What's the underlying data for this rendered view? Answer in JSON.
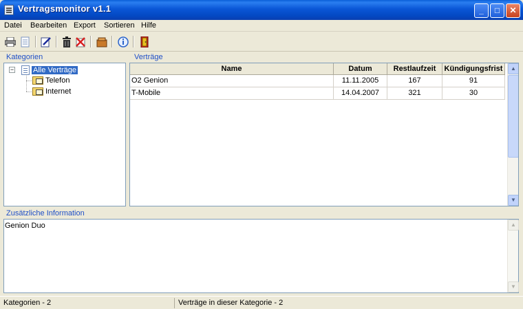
{
  "window": {
    "title": "Vertragsmonitor v1.1"
  },
  "menu": [
    "Datei",
    "Bearbeiten",
    "Export",
    "Sortieren",
    "Hilfe"
  ],
  "toolbar_icons": [
    "print-icon",
    "preview-icon",
    "edit-icon",
    "delete-icon",
    "delete-x-icon",
    "package-icon",
    "info-icon",
    "exit-door-icon"
  ],
  "categories": {
    "label": "Kategorien",
    "root": "Alle Verträge",
    "children": [
      "Telefon",
      "Internet"
    ]
  },
  "contracts": {
    "label": "Verträge",
    "columns": [
      "Name",
      "Datum",
      "Restlaufzeit",
      "Kündigungsfrist"
    ],
    "rows": [
      {
        "name": "O2 Genion",
        "datum": "11.11.2005",
        "restlaufzeit": "167",
        "kuendigungsfrist": "91"
      },
      {
        "name": "T-Mobile",
        "datum": "14.04.2007",
        "restlaufzeit": "321",
        "kuendigungsfrist": "30"
      }
    ]
  },
  "info": {
    "label": "Zusätzliche Information",
    "text": "Genion Duo"
  },
  "status": {
    "left": "Kategorien - 2",
    "right": "Verträge in dieser Kategorie - 2"
  },
  "colors": {
    "titlebar": "#0a56d6",
    "selection": "#316ac5",
    "group_label": "#1f4fc7"
  }
}
